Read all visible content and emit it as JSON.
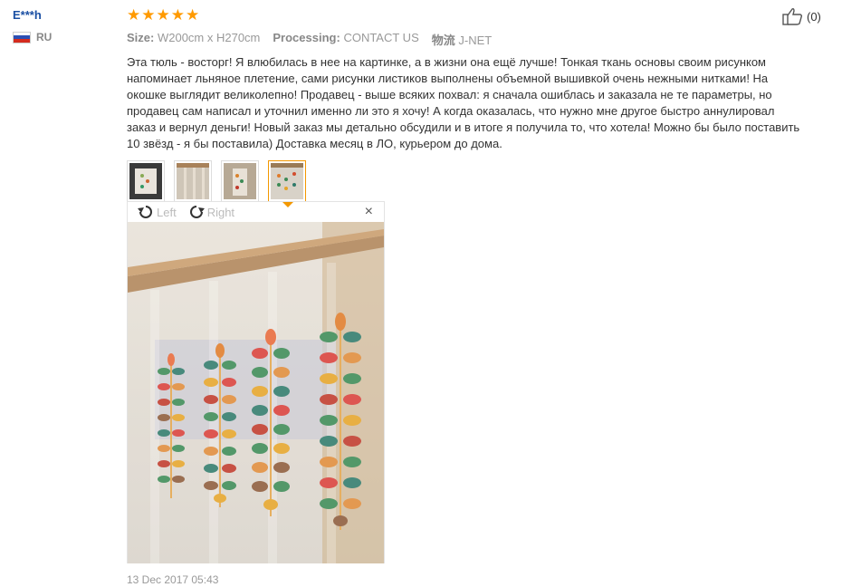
{
  "reviewer": {
    "name": "E***h",
    "country": "RU"
  },
  "rating": {
    "stars": 5,
    "max": 5
  },
  "attributes": {
    "size_label": "Size:",
    "size_value": "W200cm x H270cm",
    "processing_label": "Processing:",
    "processing_value": "CONTACT US",
    "logistics_label": "物流",
    "logistics_value": "J-NET"
  },
  "review_text": "Эта тюль - восторг! Я влюбилась в нее на картинке, а в жизни она ещё лучше! Тонкая ткань основы своим рисунком напоминает льняное плетение, сами рисунки листиков выполнены объемной вышивкой очень нежными нитками! На окошке выглядит великолепно! Продавец - выше всяких похвал: я сначала ошиблась и заказала не те параметры, но продавец сам написал и уточнил именно ли это я хочу! А когда оказалась, что нужно мне другое быстро аннулировал заказ и вернул деньги! Новый заказ мы детально обсудили и в итоге я получила то, что хотела! Можно бы было поставить 10 звёзд - я бы поставила) Доставка месяц в ЛО, курьером до дома.",
  "thumbnails": [
    {
      "icon": "photo-thumbnail",
      "active": false
    },
    {
      "icon": "photo-thumbnail",
      "active": false
    },
    {
      "icon": "photo-thumbnail",
      "active": false
    },
    {
      "icon": "photo-thumbnail",
      "active": true
    }
  ],
  "viewer": {
    "rotate_left_label": "Left",
    "rotate_right_label": "Right",
    "close_label": "×"
  },
  "timestamp": "13 Dec 2017 05:43",
  "helpful": {
    "count_label": "(0)"
  },
  "colors": {
    "star": "#ff9a00",
    "username": "#1a4fa3",
    "accent": "#f39800"
  }
}
